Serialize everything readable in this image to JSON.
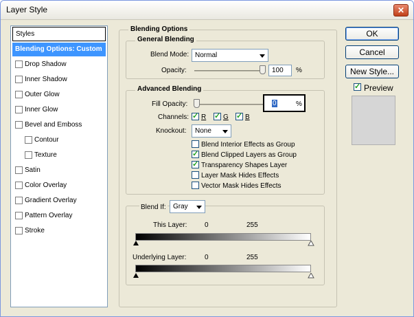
{
  "window": {
    "title": "Layer Style",
    "close_glyph": "✕"
  },
  "styles_panel": {
    "header": "Styles",
    "items": [
      {
        "label": "Blending Options: Custom",
        "checked": null,
        "selected": true
      },
      {
        "label": "Drop Shadow",
        "checked": false
      },
      {
        "label": "Inner Shadow",
        "checked": false
      },
      {
        "label": "Outer Glow",
        "checked": false
      },
      {
        "label": "Inner Glow",
        "checked": false
      },
      {
        "label": "Bevel and Emboss",
        "checked": false
      },
      {
        "label": "Contour",
        "checked": false
      },
      {
        "label": "Texture",
        "checked": false
      },
      {
        "label": "Satin",
        "checked": false
      },
      {
        "label": "Color Overlay",
        "checked": false
      },
      {
        "label": "Gradient Overlay",
        "checked": false
      },
      {
        "label": "Pattern Overlay",
        "checked": false
      },
      {
        "label": "Stroke",
        "checked": false
      }
    ]
  },
  "blending_options": {
    "title": "Blending Options",
    "general": {
      "title": "General Blending",
      "blend_mode_label": "Blend Mode:",
      "blend_mode_value": "Normal",
      "opacity_label": "Opacity:",
      "opacity_value": "100",
      "opacity_percent": 1.0,
      "unit": "%"
    },
    "advanced": {
      "title": "Advanced Blending",
      "fill_opacity_label": "Fill Opacity:",
      "fill_opacity_value": "0",
      "fill_opacity_percent": 0.0,
      "unit": "%",
      "channels_label": "Channels:",
      "channels": [
        {
          "label": "R",
          "checked": true
        },
        {
          "label": "G",
          "checked": true
        },
        {
          "label": "B",
          "checked": true
        }
      ],
      "knockout_label": "Knockout:",
      "knockout_value": "None",
      "options": [
        {
          "label": "Blend Interior Effects as Group",
          "checked": false
        },
        {
          "label": "Blend Clipped Layers as Group",
          "checked": true
        },
        {
          "label": "Transparency Shapes Layer",
          "checked": true
        },
        {
          "label": "Layer Mask Hides Effects",
          "checked": false
        },
        {
          "label": "Vector Mask Hides Effects",
          "checked": false
        }
      ]
    },
    "blend_if": {
      "label": "Blend If:",
      "value": "Gray",
      "this_layer_label": "This Layer:",
      "this_layer_low": "0",
      "this_layer_high": "255",
      "underlying_label": "Underlying Layer:",
      "underlying_low": "0",
      "underlying_high": "255"
    }
  },
  "buttons": {
    "ok": "OK",
    "cancel": "Cancel",
    "new_style": "New Style...",
    "preview_label": "Preview",
    "preview_checked": true
  }
}
